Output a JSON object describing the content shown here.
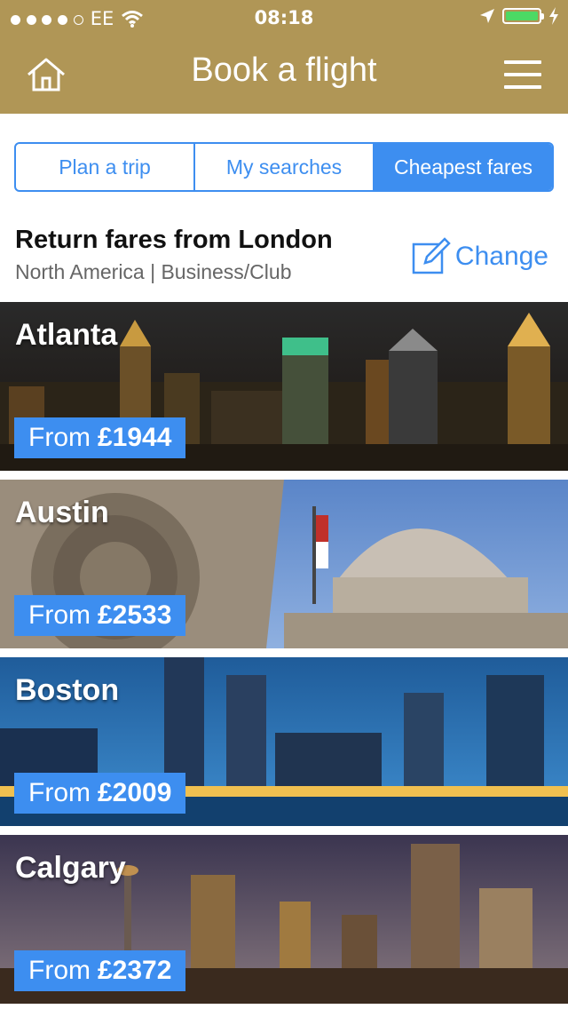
{
  "status_bar": {
    "carrier": "EE",
    "time": "08:18"
  },
  "header": {
    "title": "Book a flight"
  },
  "tabs": [
    {
      "label": "Plan a trip",
      "active": false
    },
    {
      "label": "My searches",
      "active": false
    },
    {
      "label": "Cheapest fares",
      "active": true
    }
  ],
  "fares": {
    "title": "Return fares from London",
    "subtitle": "North America | Business/Club",
    "change_label": "Change"
  },
  "destinations": [
    {
      "city": "Atlanta",
      "from_label": "From",
      "price": "£1944"
    },
    {
      "city": "Austin",
      "from_label": "From",
      "price": "£2533"
    },
    {
      "city": "Boston",
      "from_label": "From",
      "price": "£2009"
    },
    {
      "city": "Calgary",
      "from_label": "From",
      "price": "£2372"
    }
  ],
  "colors": {
    "brand": "#b09656",
    "accent": "#3d8ef0",
    "battery": "#4cd964"
  }
}
